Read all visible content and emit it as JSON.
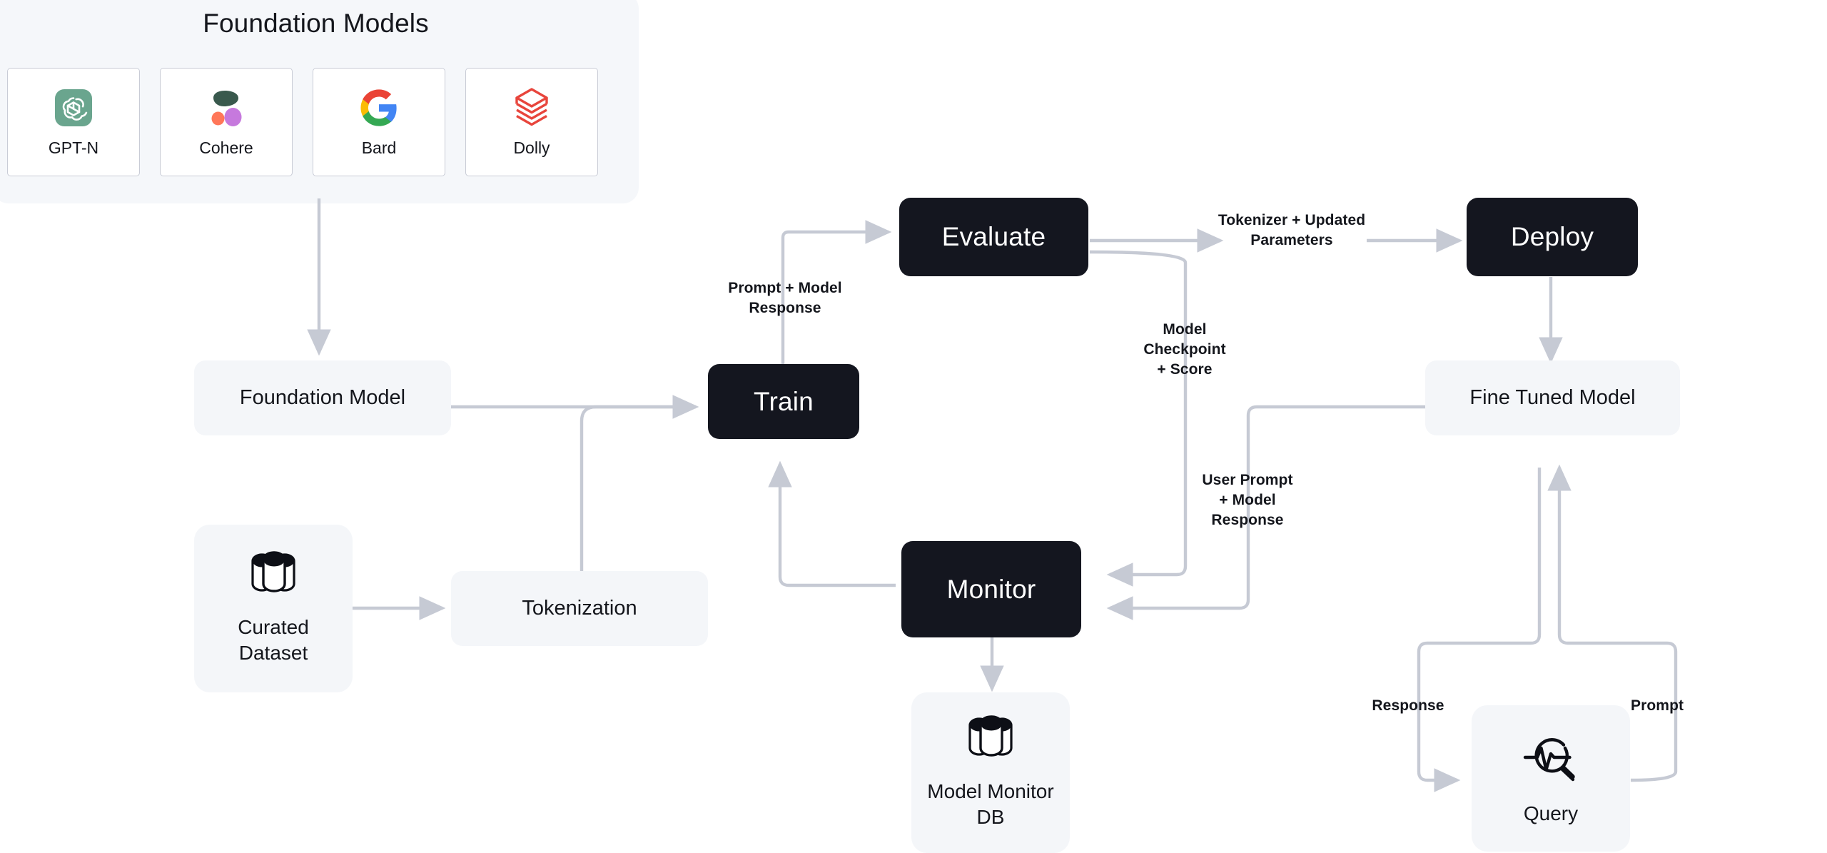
{
  "panel": {
    "title": "Foundation Models",
    "cards": [
      {
        "id": "gpt-n",
        "label": "GPT-N",
        "icon": "openai-logo-icon",
        "color": "#6aa58e"
      },
      {
        "id": "cohere",
        "label": "Cohere",
        "icon": "cohere-logo-icon",
        "color": "#39594d"
      },
      {
        "id": "bard",
        "label": "Bard",
        "icon": "google-logo-icon",
        "color": "#4285f4"
      },
      {
        "id": "dolly",
        "label": "Dolly",
        "icon": "databricks-logo-icon",
        "color": "#e8453c"
      }
    ]
  },
  "nodes": {
    "foundation_model": "Foundation Model",
    "curated_dataset": "Curated\nDataset",
    "curated_dataset_l1": "Curated",
    "curated_dataset_l2": "Dataset",
    "tokenization": "Tokenization",
    "train": "Train",
    "evaluate": "Evaluate",
    "deploy": "Deploy",
    "monitor": "Monitor",
    "fine_tuned_model": "Fine Tuned Model",
    "model_monitor_db_l1": "Model Monitor",
    "model_monitor_db_l2": "DB",
    "query": "Query"
  },
  "edge_labels": {
    "prompt_model_response_l1": "Prompt + Model",
    "prompt_model_response_l2": "Response",
    "tokenizer_updated_l1": "Tokenizer + Updated",
    "tokenizer_updated_l2": "Parameters",
    "model_checkpoint_score_l1": "Model",
    "model_checkpoint_score_l2": "Checkpoint",
    "model_checkpoint_score_l3": "+ Score",
    "user_prompt_model_response_l1": "User Prompt",
    "user_prompt_model_response_l2": "+ Model",
    "user_prompt_model_response_l3": "Response",
    "response": "Response",
    "prompt": "Prompt"
  },
  "colors": {
    "panel_bg": "#f5f7fa",
    "node_soft_bg": "#f4f6f9",
    "node_dark_bg": "#14161f",
    "wire": "#c6cad4",
    "card_border": "#c9ccd6",
    "text": "#14161c"
  }
}
